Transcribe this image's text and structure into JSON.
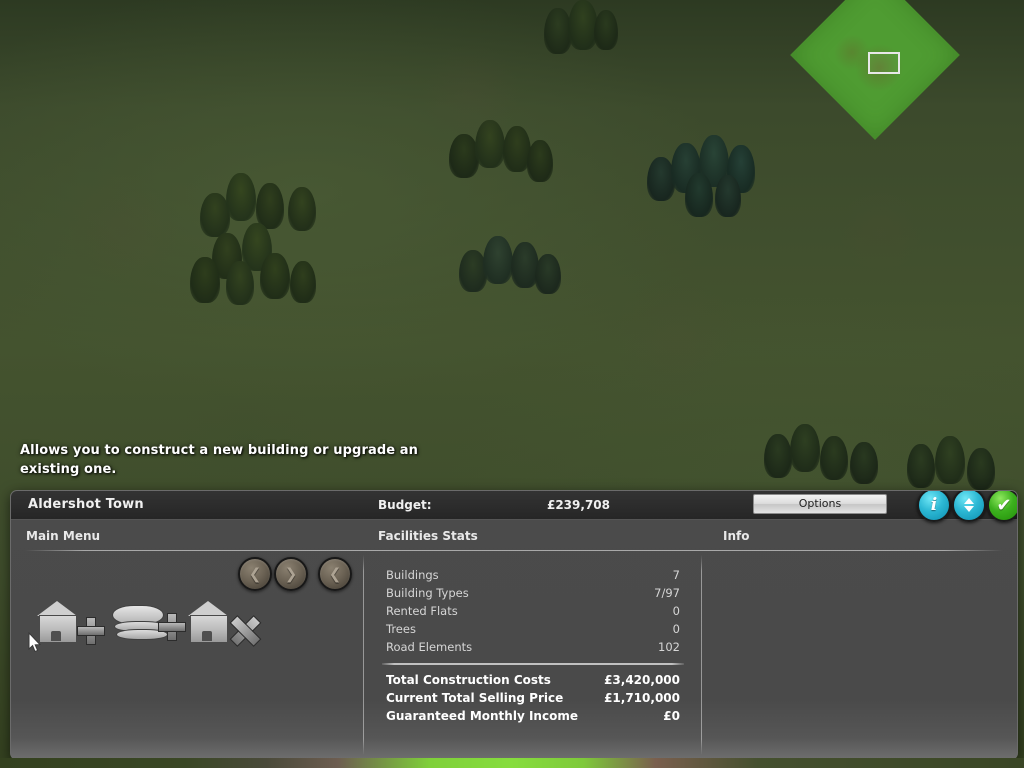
{
  "tooltip": {
    "text": "Allows you to construct a new building or upgrade an existing one."
  },
  "panel": {
    "title": "Aldershot Town",
    "budget_label": "Budget:",
    "budget_value": "£239,708",
    "options_label": "Options",
    "buttons": {
      "info": {
        "name": "info-button",
        "glyph": "i",
        "color": "#2cb8d4"
      },
      "updown": {
        "name": "updown-button",
        "glyph": "⌃⌄",
        "color": "#2cb8d4"
      },
      "confirm": {
        "name": "confirm-button",
        "glyph": "✔",
        "color": "#3cb01e"
      }
    },
    "sections": {
      "main_menu": "Main Menu",
      "facilities_stats": "Facilities Stats",
      "info": "Info"
    }
  },
  "toolbar": {
    "nav": [
      {
        "name": "nav-prev-button",
        "glyph": "❮"
      },
      {
        "name": "nav-next-button",
        "glyph": "❯"
      },
      {
        "name": "nav-back-button",
        "glyph": "❮"
      }
    ],
    "tools": [
      {
        "name": "build-building-tool",
        "icon": "house-plus-icon"
      },
      {
        "name": "add-floor-tool",
        "icon": "layers-plus-icon"
      },
      {
        "name": "demolish-building-tool",
        "icon": "house-x-icon"
      }
    ]
  },
  "stats": {
    "rows": [
      {
        "label": "Buildings",
        "value": "7"
      },
      {
        "label": "Building Types",
        "value": "7/97"
      },
      {
        "label": "Rented Flats",
        "value": "0"
      },
      {
        "label": "Trees",
        "value": "0"
      },
      {
        "label": "Road Elements",
        "value": "102"
      }
    ],
    "totals": [
      {
        "label": "Total Construction Costs",
        "value": "£3,420,000"
      },
      {
        "label": "Current Total Selling Price",
        "value": "£1,710,000"
      },
      {
        "label": "Guaranteed Monthly Income",
        "value": "£0"
      }
    ]
  },
  "world": {
    "plot_color": "#4f9c32",
    "terrain_color": "#44532f",
    "cursor_highlight": "#e8e8e8"
  }
}
